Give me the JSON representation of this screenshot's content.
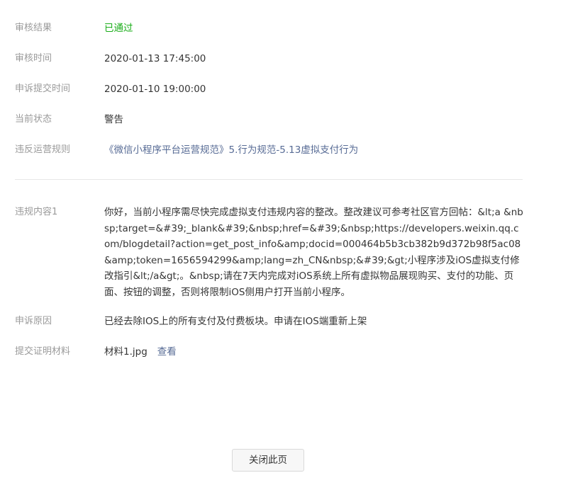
{
  "details": {
    "review_result": {
      "label": "审核结果",
      "value": "已通过"
    },
    "review_time": {
      "label": "审核时间",
      "value": "2020-01-13 17:45:00"
    },
    "appeal_submit_time": {
      "label": "申诉提交时间",
      "value": "2020-01-10 19:00:00"
    },
    "current_status": {
      "label": "当前状态",
      "value": "警告"
    },
    "violated_rule": {
      "label": "违反运营规则",
      "value": "《微信小程序平台运营规范》5.行为规范-5.13虚拟支付行为"
    }
  },
  "violation": {
    "label": "违规内容1",
    "content": "你好，当前小程序需尽快完成虚拟支付违规内容的整改。整改建议可参考社区官方回帖：&lt;a &nbsp;target=&#39;_blank&#39;&nbsp;href=&#39;&nbsp;https://developers.weixin.qq.com/blogdetail?action=get_post_info&amp;docid=000464b5b3cb382b9d372b98f5ac08&amp;token=1656594299&amp;lang=zh_CN&nbsp;&#39;&gt;小程序涉及iOS虚拟支付修改指引&lt;/a&gt;。&nbsp;请在7天内完成对iOS系统上所有虚拟物品展现购买、支付的功能、页面、按钮的调整，否则将限制iOS侧用户打开当前小程序。"
  },
  "appeal_reason": {
    "label": "申诉原因",
    "value": "已经去除IOS上的所有支付及付费板块。申请在IOS端重新上架"
  },
  "evidence": {
    "label": "提交证明材料",
    "file_name": "材料1.jpg",
    "view_label": "查看"
  },
  "footer": {
    "close_label": "关闭此页"
  },
  "colors": {
    "label_gray": "#9a9a9a",
    "pass_green": "#1aad19",
    "link_blue": "#576b95"
  }
}
